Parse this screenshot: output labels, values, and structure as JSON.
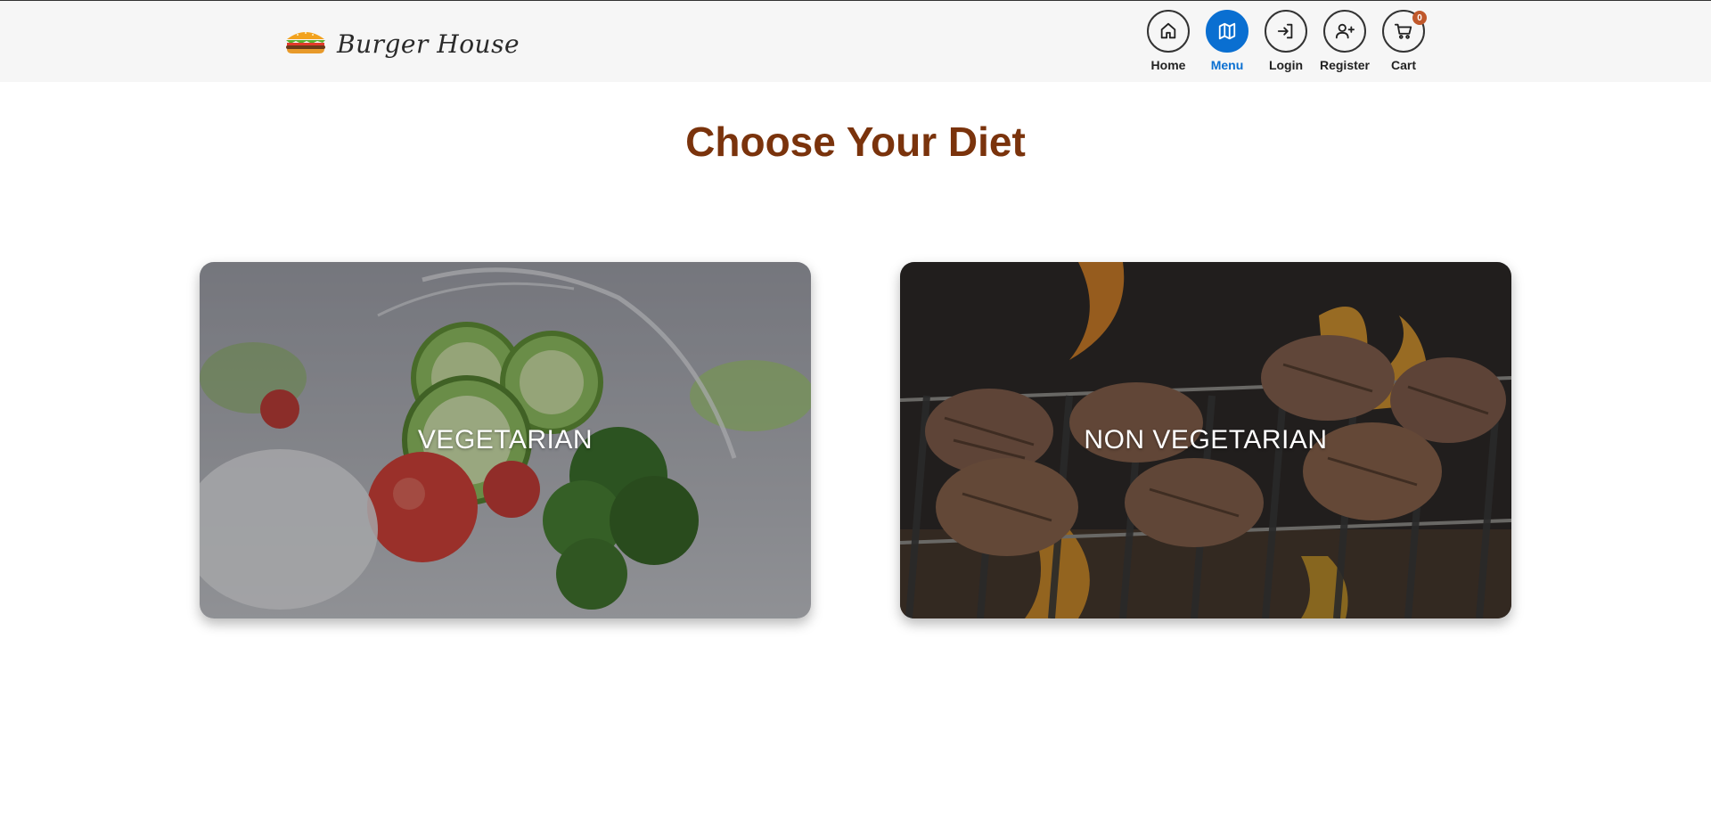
{
  "header": {
    "brand_name": "Burger House",
    "nav": [
      {
        "label": "Home",
        "icon": "home-icon",
        "active": false
      },
      {
        "label": "Menu",
        "icon": "map-icon",
        "active": true
      },
      {
        "label": "Login",
        "icon": "login-icon",
        "active": false
      },
      {
        "label": "Register",
        "icon": "user-plus-icon",
        "active": false
      },
      {
        "label": "Cart",
        "icon": "cart-icon",
        "active": false,
        "badge": "0"
      }
    ]
  },
  "main": {
    "title": "Choose Your Diet",
    "cards": [
      {
        "label": "VEGETARIAN"
      },
      {
        "label": "NON VEGETARIAN"
      }
    ]
  },
  "colors": {
    "header_bg": "#f6f6f6",
    "title": "#7a330c",
    "accent": "#0a6fd1",
    "badge": "#c0582b"
  }
}
